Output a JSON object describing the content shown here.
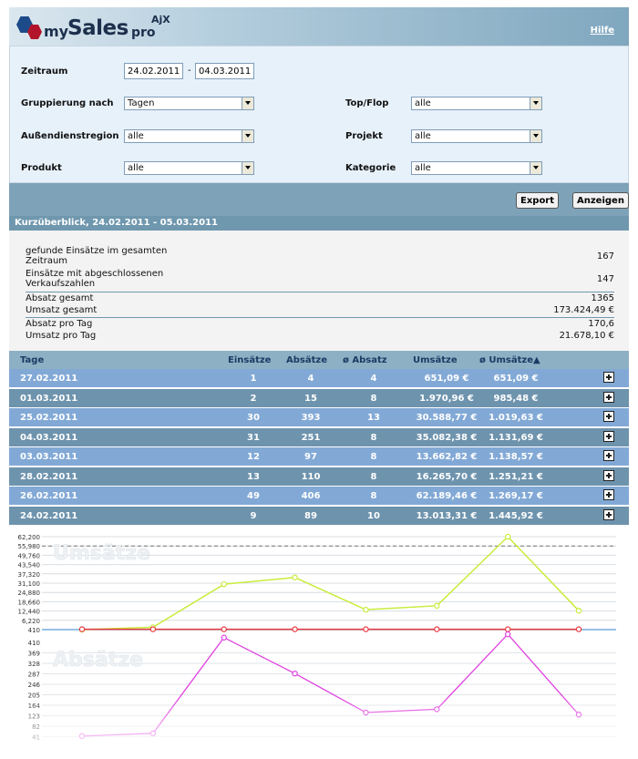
{
  "header": {
    "logo": {
      "my": "my",
      "sales": "Sales",
      "pro": "pro",
      "ajx": "AjX"
    },
    "help_link": "Hilfe"
  },
  "filters": {
    "period_label": "Zeitraum",
    "date_from": "24.02.2011",
    "date_separator": "-",
    "date_to": "04.03.2011",
    "grouping_label": "Gruppierung nach",
    "grouping_value": "Tagen",
    "topflop_label": "Top/Flop",
    "topflop_value": "alle",
    "region_label": "Außendienstregion",
    "region_value": "alle",
    "project_label": "Projekt",
    "project_value": "alle",
    "product_label": "Produkt",
    "product_value": "alle",
    "category_label": "Kategorie",
    "category_value": "alle"
  },
  "actions": {
    "export_label": "Export",
    "show_label": "Anzeigen"
  },
  "summary": {
    "title": "Kurzüberblick, 24.02.2011 - 05.03.2011",
    "rows": [
      {
        "label": "gefunde Einsätze im gesamten Zeitraum",
        "value": "167"
      },
      {
        "label": "Einsätze mit abgeschlossenen Verkaufszahlen",
        "value": "147"
      },
      {
        "label": "Absatz gesamt",
        "value": "1365"
      },
      {
        "label": "Umsatz gesamt",
        "value": "173.424,49 €"
      },
      {
        "label": "Absatz pro Tag",
        "value": "170,6"
      },
      {
        "label": "Umsatz pro Tag",
        "value": "21.678,10 €"
      }
    ]
  },
  "table": {
    "columns": [
      "Tage",
      "Einsätze",
      "Absätze",
      "ø Absatz",
      "Umsätze",
      "ø Umsätze▲"
    ],
    "rows": [
      [
        "27.02.2011",
        "1",
        "4",
        "4",
        "651,09 €",
        "651,09 €"
      ],
      [
        "01.03.2011",
        "2",
        "15",
        "8",
        "1.970,96 €",
        "985,48 €"
      ],
      [
        "25.02.2011",
        "30",
        "393",
        "13",
        "30.588,77 €",
        "1.019,63 €"
      ],
      [
        "04.03.2011",
        "31",
        "251",
        "8",
        "35.082,38 €",
        "1.131,69 €"
      ],
      [
        "03.03.2011",
        "12",
        "97",
        "8",
        "13.662,82 €",
        "1.138,57 €"
      ],
      [
        "28.02.2011",
        "13",
        "110",
        "8",
        "16.265,70 €",
        "1.251,21 €"
      ],
      [
        "26.02.2011",
        "49",
        "406",
        "8",
        "62.189,46 €",
        "1.269,17 €"
      ],
      [
        "24.02.2011",
        "9",
        "89",
        "10",
        "13.013,31 €",
        "1.445,92 €"
      ]
    ]
  },
  "chart_data": [
    {
      "type": "line",
      "title": "Umsätze",
      "y_ticks": [
        "62,200",
        "55,980",
        "49,760",
        "43,540",
        "37,320",
        "31,100",
        "24,880",
        "18,660",
        "12,440",
        "6,220",
        "410"
      ],
      "ylim": [
        410,
        62200
      ],
      "reference_line": 55980,
      "series": [
        {
          "color": "#c8ec3a",
          "values": [
            410,
            1970,
            30588,
            35082,
            13662,
            16265,
            62189,
            13013
          ]
        },
        {
          "color": "#e8383f",
          "values": [
            651,
            651,
            651,
            651,
            651,
            651,
            651,
            651
          ]
        }
      ]
    },
    {
      "type": "line",
      "title": "Absätze",
      "y_ticks": [
        "410",
        "369",
        "328",
        "287",
        "246",
        "205",
        "164",
        "123",
        "82",
        "41"
      ],
      "ylim": [
        0,
        410
      ],
      "series": [
        {
          "color": "#e040e0",
          "values": [
            4,
            15,
            393,
            251,
            97,
            110,
            406,
            89
          ]
        }
      ]
    }
  ]
}
